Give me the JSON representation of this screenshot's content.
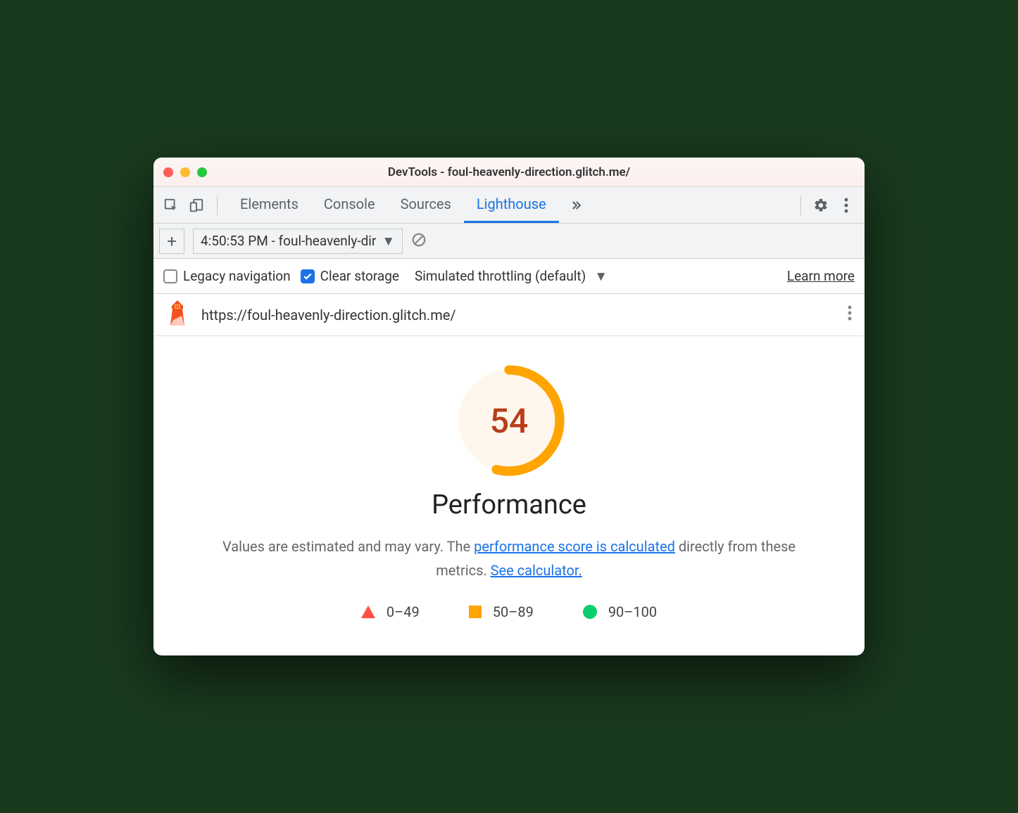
{
  "window": {
    "title": "DevTools - foul-heavenly-direction.glitch.me/"
  },
  "tabs": {
    "items": [
      "Elements",
      "Console",
      "Sources",
      "Lighthouse"
    ],
    "active": "Lighthouse"
  },
  "subbar": {
    "run_label": "4:50:53 PM - foul-heavenly-dir"
  },
  "options": {
    "legacy_label": "Legacy navigation",
    "legacy_checked": false,
    "clear_label": "Clear storage",
    "clear_checked": true,
    "throttling_label": "Simulated throttling (default)",
    "learn_more": "Learn more"
  },
  "urlbar": {
    "url": "https://foul-heavenly-direction.glitch.me/"
  },
  "report": {
    "score": "54",
    "score_pct": 54,
    "title": "Performance",
    "desc_prefix": "Values are estimated and may vary. The ",
    "desc_link1": "performance score is calculated",
    "desc_mid": " directly from these metrics. ",
    "desc_link2": "See calculator.",
    "legend": {
      "low": "0–49",
      "mid": "50–89",
      "high": "90–100"
    },
    "colors": {
      "low": "#ff4e42",
      "mid": "#ffa400",
      "high": "#0cce6b"
    }
  }
}
